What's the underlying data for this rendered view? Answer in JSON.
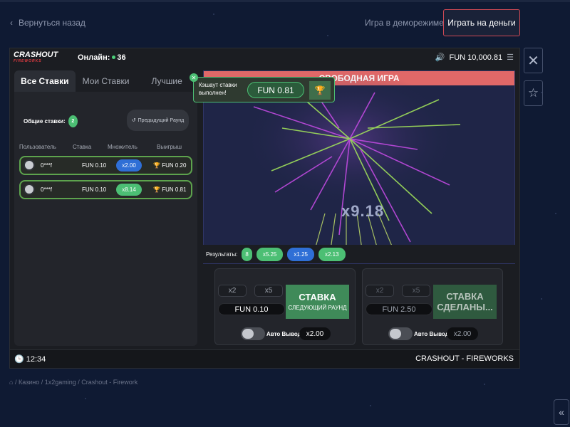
{
  "site": {
    "back_label": "Вернуться назад",
    "demo_label": "Игра в деморежиме",
    "real_label": "Играть на деньги",
    "breadcrumb": "/ Казино / 1x2gaming / Crashout - Firework"
  },
  "game": {
    "logo_main": "CRASHOUT",
    "logo_sub": "FIREWORKS",
    "online_label": "Онлайн:",
    "online_count": "36",
    "balance": "FUN 10,000.81",
    "stage_title": "СВОБОДНАЯ ИГРА",
    "multiplier": "x9.18",
    "clock": "12:34",
    "game_name": "CRASHOUT - FIREWORKS"
  },
  "bets": {
    "tabs": [
      "Все Ставки",
      "Мои Ставки",
      "Лучшие"
    ],
    "totals_label": "Общие ставки:",
    "totals_count": "2",
    "prev_round": "Предыдущий Раунд",
    "columns": [
      "Пользователь",
      "Ставка",
      "Множитель",
      "Выигрыш"
    ],
    "rows": [
      {
        "user": "0***f",
        "stake": "FUN 0.10",
        "mult": "x2.00",
        "mult_color": "#2f6fd6",
        "win": "FUN 0.20"
      },
      {
        "user": "0***f",
        "stake": "FUN 0.10",
        "mult": "x8.14",
        "mult_color": "#4cbf74",
        "win": "FUN 0.81"
      }
    ]
  },
  "toast": {
    "text": "Кэшаут ставки выполнен!",
    "amount": "FUN 0.81"
  },
  "results": {
    "label": "Результаты:",
    "chips": [
      {
        "v": "8",
        "color": "#4cbf74"
      },
      {
        "v": "x5.25",
        "color": "#4cbf74"
      },
      {
        "v": "x1.25",
        "color": "#2f6fd6"
      },
      {
        "v": "x2.13",
        "color": "#4cbf74"
      }
    ]
  },
  "panel1": {
    "q1": "x2",
    "q2": "x5",
    "amount": "FUN 0.10",
    "bet_title": "СТАВКА",
    "bet_sub": "СЛЕДУЮЩИЙ РАУНД",
    "auto_label": "Авто Вывод",
    "auto_value": "x2.00"
  },
  "panel2": {
    "q1": "x2",
    "q2": "x5",
    "amount": "FUN 2.50",
    "bet_title": "СТАВКА",
    "bet_sub": "СДЕЛАНЫ...",
    "auto_label": "Авто Вывод",
    "auto_value": "x2.00"
  },
  "colors": {
    "accent_green": "#4cbf74",
    "accent_blue": "#2f6fd6",
    "title_bar": "#e06868",
    "cta_border": "#d24a55"
  }
}
